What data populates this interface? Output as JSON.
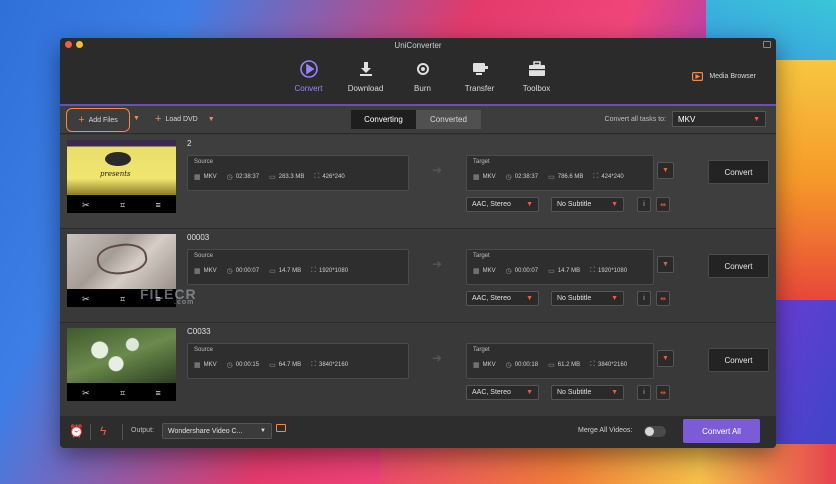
{
  "window": {
    "title": "UniConverter"
  },
  "nav": {
    "tabs": [
      {
        "label": "Convert",
        "icon": "convert-icon",
        "active": true
      },
      {
        "label": "Download",
        "icon": "download-icon",
        "active": false
      },
      {
        "label": "Burn",
        "icon": "burn-icon",
        "active": false
      },
      {
        "label": "Transfer",
        "icon": "transfer-icon",
        "active": false
      },
      {
        "label": "Toolbox",
        "icon": "toolbox-icon",
        "active": false
      }
    ],
    "media_browser": "Media Browser"
  },
  "toolbar": {
    "add_files": "Add Files",
    "load_dvd": "Load DVD",
    "segments": [
      "Converting",
      "Converted"
    ],
    "convert_all_to_label": "Convert all tasks to:",
    "convert_all_to_value": "MKV"
  },
  "items": [
    {
      "name": "2",
      "source": {
        "label": "Source",
        "format": "MKV",
        "duration": "02:38:37",
        "size": "283.3 MB",
        "resolution": "426*240"
      },
      "target": {
        "label": "Target",
        "format": "MKV",
        "duration": "02:38:37",
        "size": "786.6 MB",
        "resolution": "424*240"
      },
      "audio": "AAC, Stereo",
      "subtitle": "No Subtitle",
      "convert": "Convert",
      "thumb_text": "presents"
    },
    {
      "name": "00003",
      "source": {
        "label": "Source",
        "format": "MKV",
        "duration": "00:00:07",
        "size": "14.7 MB",
        "resolution": "1920*1080"
      },
      "target": {
        "label": "Target",
        "format": "MKV",
        "duration": "00:00:07",
        "size": "14.7 MB",
        "resolution": "1920*1080"
      },
      "audio": "AAC, Stereo",
      "subtitle": "No Subtitle",
      "convert": "Convert"
    },
    {
      "name": "C0033",
      "source": {
        "label": "Source",
        "format": "MKV",
        "duration": "00:00:15",
        "size": "64.7 MB",
        "resolution": "3840*2160"
      },
      "target": {
        "label": "Target",
        "format": "MKV",
        "duration": "00:00:18",
        "size": "61.2 MB",
        "resolution": "3840*2160"
      },
      "audio": "AAC, Stereo",
      "subtitle": "No Subtitle",
      "convert": "Convert"
    }
  ],
  "footer": {
    "output_label": "Output:",
    "output_value": "Wondershare Video C...",
    "merge_label": "Merge All Videos:",
    "merge_on": false,
    "convert_all": "Convert All"
  },
  "watermark": {
    "main": "FILECR",
    "sub": ".com"
  },
  "colors": {
    "accent": "#7b5cd6",
    "highlight": "#f08a4b",
    "active_tab": "#9b83ff"
  }
}
